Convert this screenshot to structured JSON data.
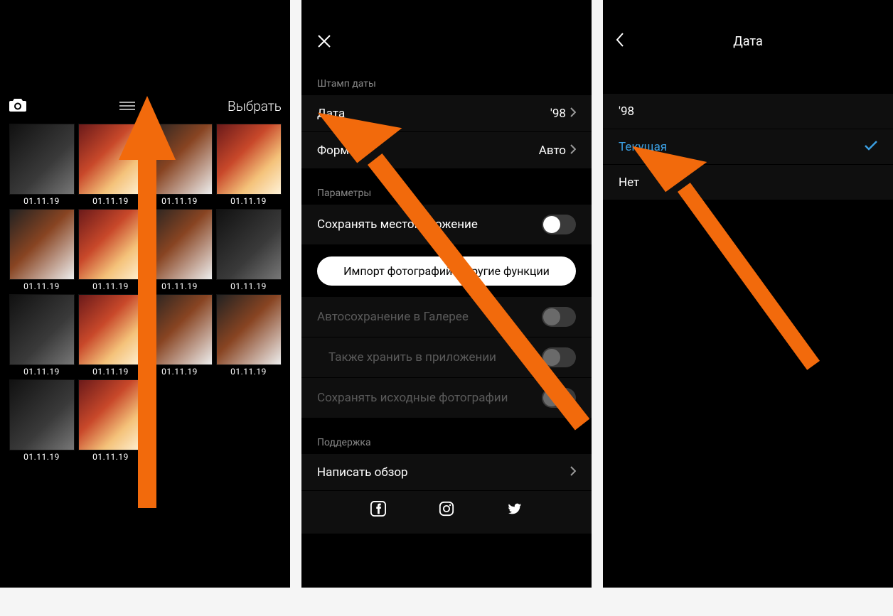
{
  "screen1": {
    "select_label": "Выбрать",
    "icons": {
      "camera": "camera-icon",
      "menu": "menu-icon"
    },
    "photo_date": "01.11.19",
    "photo_count": 14
  },
  "screen2": {
    "sections": {
      "stamp": "Штамп даты",
      "params": "Параметры",
      "support": "Поддержка"
    },
    "rows": {
      "date_label": "Дата",
      "date_value": "'98",
      "format_label": "Формат",
      "format_value": "Авто",
      "save_location_label": "Сохранять местоположение",
      "import_btn": "Импорт фотографий и другие функции",
      "autosave_label": "Автосохранение в Галерее",
      "also_store_label": "Также хранить в приложении",
      "save_originals_label": "Сохранять исходные фотографии",
      "write_review_label": "Написать обзор"
    },
    "toggles": {
      "save_location": false,
      "autosave": false,
      "also_store": false,
      "save_originals": false
    },
    "socials": [
      "facebook",
      "instagram",
      "twitter"
    ]
  },
  "screen3": {
    "title": "Дата",
    "options": {
      "opt1": "'98",
      "opt2": "Текущая",
      "opt3": "Нет"
    },
    "selected": "opt2"
  }
}
